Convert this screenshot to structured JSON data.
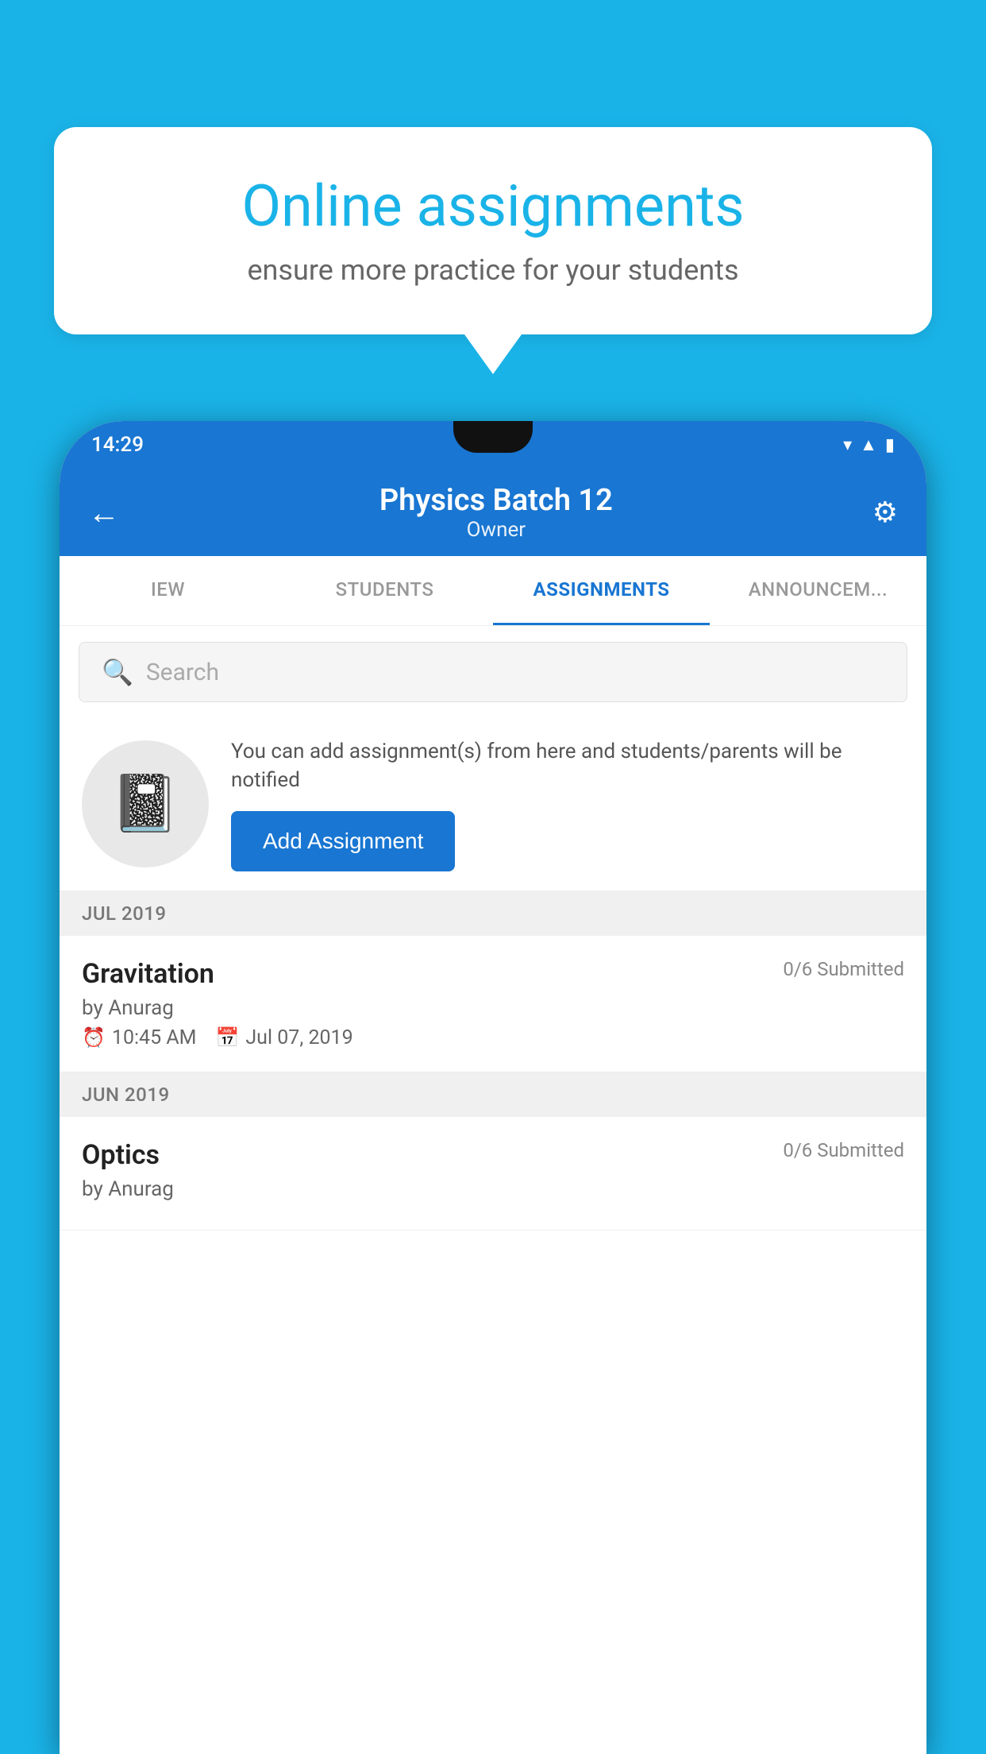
{
  "background_color": "#1ab3e8",
  "speech_bubble": {
    "title": "Online assignments",
    "subtitle": "ensure more practice for your students"
  },
  "status_bar": {
    "time": "14:29",
    "icons": [
      "wifi",
      "signal",
      "battery"
    ]
  },
  "app_bar": {
    "title": "Physics Batch 12",
    "subtitle": "Owner",
    "back_label": "←",
    "settings_label": "⚙"
  },
  "tabs": [
    {
      "label": "IEW",
      "active": false
    },
    {
      "label": "STUDENTS",
      "active": false
    },
    {
      "label": "ASSIGNMENTS",
      "active": true
    },
    {
      "label": "ANNOUNCEM...",
      "active": false
    }
  ],
  "search": {
    "placeholder": "Search"
  },
  "promo_card": {
    "description": "You can add assignment(s) from here and students/parents will be notified",
    "button_label": "Add Assignment"
  },
  "sections": [
    {
      "month": "JUL 2019",
      "assignments": [
        {
          "title": "Gravitation",
          "submitted": "0/6 Submitted",
          "by": "by Anurag",
          "time": "10:45 AM",
          "date": "Jul 07, 2019"
        }
      ]
    },
    {
      "month": "JUN 2019",
      "assignments": [
        {
          "title": "Optics",
          "submitted": "0/6 Submitted",
          "by": "by Anurag",
          "time": "",
          "date": ""
        }
      ]
    }
  ]
}
